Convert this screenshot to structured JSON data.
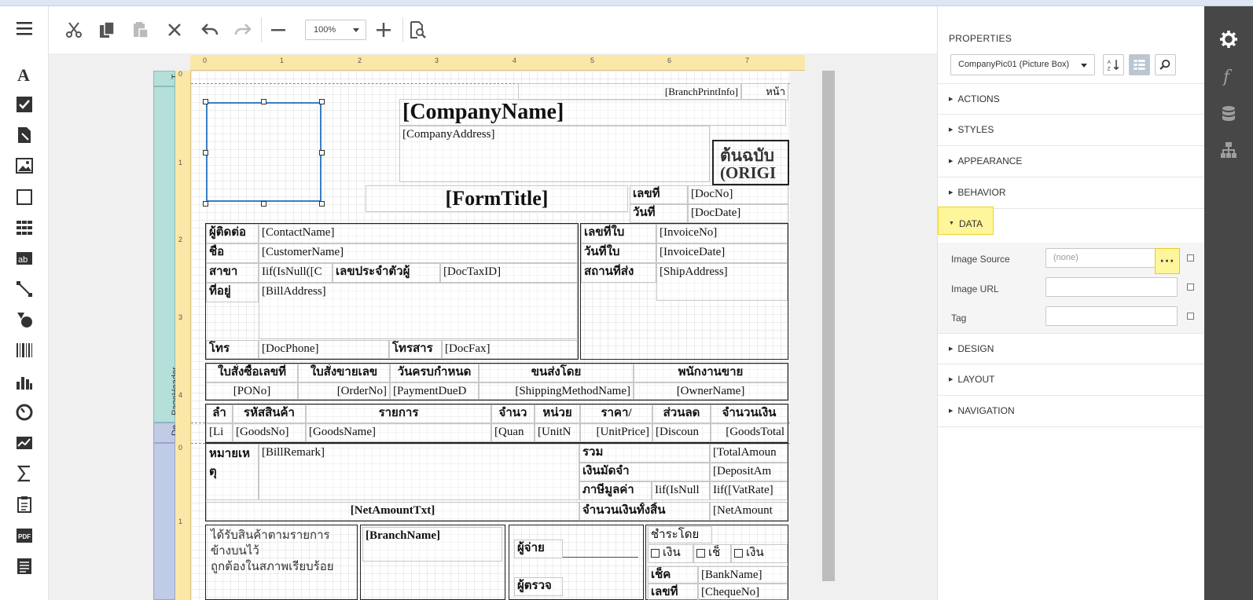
{
  "toolbar": {
    "zoom_value": "100%"
  },
  "ruler": {
    "top_ticks": [
      "0",
      "1",
      "2",
      "3",
      "4",
      "5",
      "6",
      "7"
    ],
    "left_ticks_header": [
      "0",
      "1",
      "2",
      "3",
      "4"
    ],
    "left_ticks_footer": [
      "0",
      "1"
    ]
  },
  "bands": {
    "top_label": "T",
    "page_header": "PageHeader",
    "detail": "De"
  },
  "report": {
    "branch_print_info": "[BranchPrintInfo]",
    "page_label": "หน้า",
    "company_name": "[CompanyName]",
    "company_address": "[CompanyAddress]",
    "original_line1": "ต้นฉบับ",
    "original_line2": "(ORIGI",
    "form_title": "[FormTitle]",
    "doc_no_label": "เลขที่",
    "doc_no": "[DocNo]",
    "doc_date_label": "วันที่",
    "doc_date": "[DocDate]",
    "contact_label": "ผู้ติดต่อ",
    "contact": "[ContactName]",
    "name_label": "ชื่อ",
    "customer": "[CustomerName]",
    "branch_label": "สาขา",
    "branch_expr": "Iif(IsNull([C",
    "tax_id_label": "เลขประจำตัวผู้",
    "tax_id": "[DocTaxID]",
    "address_label": "ที่อยู่",
    "bill_address": "[BillAddress]",
    "phone_label": "โทร",
    "phone": "[DocPhone]",
    "fax_label": "โทรสาร",
    "fax": "[DocFax]",
    "invoice_no_label": "เลขที่ใบ",
    "invoice_no": "[InvoiceNo]",
    "invoice_date_label": "วันที่ใบ",
    "invoice_date": "[InvoiceDate]",
    "ship_to_label": "สถานที่ส่ง",
    "ship_address": "[ShipAddress]",
    "po_label": "ใบสั่งซื้อเลขที่",
    "so_label": "ใบสั่งขายเลข",
    "due_label": "วันครบกำหนด",
    "ship_by_label": "ขนส่งโดย",
    "sales_label": "พนักงานขาย",
    "po": "[PONo]",
    "order": "[OrderNo]",
    "due": "[PaymentDueD",
    "ship_method": "[ShippingMethodName]",
    "owner": "[OwnerName]",
    "col_seq": "ลำ",
    "col_code": "รหัสสินค้า",
    "col_item": "รายการ",
    "col_qty": "จำนว",
    "col_unit": "หน่วย",
    "col_price": "ราคา/",
    "col_discount": "ส่วนลด",
    "col_amount": "จำนวนเงิน",
    "d_seq": "[Li",
    "d_code": "[GoodsNo]",
    "d_name": "[GoodsName]",
    "d_qty": "[Quan",
    "d_unit": "[UnitN",
    "d_price": "[UnitPrice]",
    "d_discount": "[Discoun",
    "d_total": "[GoodsTotal",
    "remark_label_1": "หมายเห",
    "remark_label_2": "ตุ",
    "remark": "[BillRemark]",
    "total_label": "รวม",
    "total": "[TotalAmoun",
    "deposit_label": "เงินมัดจำ",
    "deposit": "[DepositAm",
    "vat_label": "ภาษีมูลค่า",
    "vat_expr1": "Iif(IsNull",
    "vat_expr2": "Iif([VatRate]",
    "net_txt": "[NetAmountTxt]",
    "net_label": "จำนวนเงินทั้งสิ้น",
    "net": "[NetAmount",
    "received_1": "ได้รับสินค้าตามรายการ",
    "received_2": "ข้างบนไว้",
    "received_3": "ถูกต้องในสภาพเรียบร้อย",
    "branch_name": "[BranchName]",
    "payer_label": "ผู้จ่าย",
    "checker_label": "ผู้ตรวจ",
    "pay_by_label": "ชำระโดย",
    "cash_1": "เงิน",
    "cheque": "เช็",
    "cash_2": "เงิน",
    "cheque_label": "เช็ค",
    "bank_name": "[BankName]",
    "cheque_no_label": "เลขที่",
    "cheque_no": "[ChequeNo]"
  },
  "properties": {
    "title": "PROPERTIES",
    "selected_component": "CompanyPic01 (Picture Box)",
    "sections": {
      "actions": "ACTIONS",
      "styles": "STYLES",
      "appearance": "APPEARANCE",
      "behavior": "BEHAVIOR",
      "data": "DATA",
      "design": "DESIGN",
      "layout": "LAYOUT",
      "navigation": "NAVIGATION"
    },
    "data_fields": {
      "image_source_label": "Image Source",
      "image_source_value": "(none)",
      "image_url_label": "Image URL",
      "tag_label": "Tag"
    }
  },
  "colors": {
    "accent": "#3b7dc4",
    "highlight": "#fff59a",
    "ruler": "#fbe8a8",
    "page_header_band": "#b5e0da",
    "detail_band": "#c0cbe6",
    "side_dark": "#474747"
  }
}
